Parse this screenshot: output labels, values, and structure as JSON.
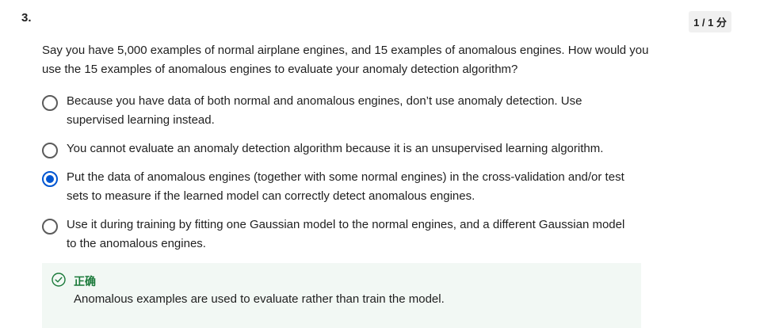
{
  "question": {
    "number": "3.",
    "score": "1 / 1 分",
    "text": "Say you have 5,000 examples of normal airplane engines, and 15 examples of anomalous engines. How would you use the 15 examples of anomalous engines to evaluate your anomaly detection algorithm?"
  },
  "options": [
    {
      "label": "Because you have data of both normal and anomalous engines, don’t use anomaly detection. Use supervised learning instead.",
      "selected": false
    },
    {
      "label": "You cannot evaluate an anomaly detection algorithm because it is an unsupervised learning algorithm.",
      "selected": false
    },
    {
      "label": "Put the data of anomalous engines (together with some normal engines) in the cross-validation and/or test sets to measure if the learned model can correctly detect anomalous engines.",
      "selected": true
    },
    {
      "label": "Use it during training by fitting one Gaussian model to the normal engines, and a different Gaussian model to the anomalous engines.",
      "selected": false
    }
  ],
  "feedback": {
    "status": "正确",
    "text": "Anomalous examples are used to evaluate rather than train the model.",
    "icon": "check-circle-icon",
    "color": "#1b7a3a"
  },
  "colors": {
    "accent": "#0056d2",
    "feedback_bg": "#f2f8f4"
  }
}
